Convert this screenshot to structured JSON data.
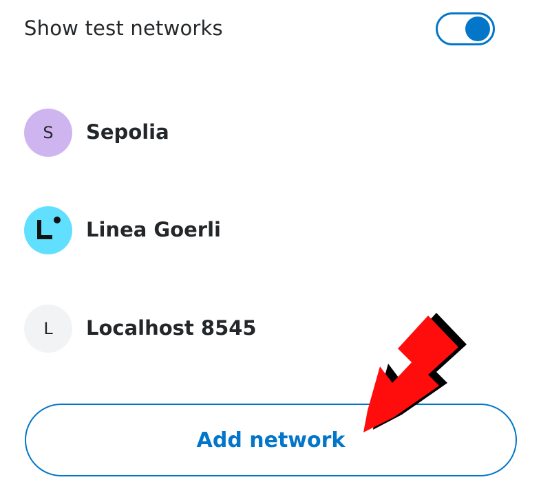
{
  "settings": {
    "show_test_networks_label": "Show test networks",
    "show_test_networks_enabled": true
  },
  "networks": [
    {
      "avatar_text": "S",
      "name": "Sepolia",
      "icon": "sepolia-icon"
    },
    {
      "avatar_text": "",
      "name": "Linea Goerli",
      "icon": "linea-logo-icon"
    },
    {
      "avatar_text": "L",
      "name": "Localhost 8545",
      "icon": "localhost-icon"
    }
  ],
  "actions": {
    "add_network_label": "Add network"
  },
  "colors": {
    "accent": "#0376c9",
    "sepolia_avatar": "#cfb5f0",
    "linea_avatar": "#61dfff",
    "localhost_avatar": "#f2f3f4",
    "annotation_arrow": "#ff0000"
  },
  "annotation": {
    "icon": "red-arrow-icon"
  }
}
